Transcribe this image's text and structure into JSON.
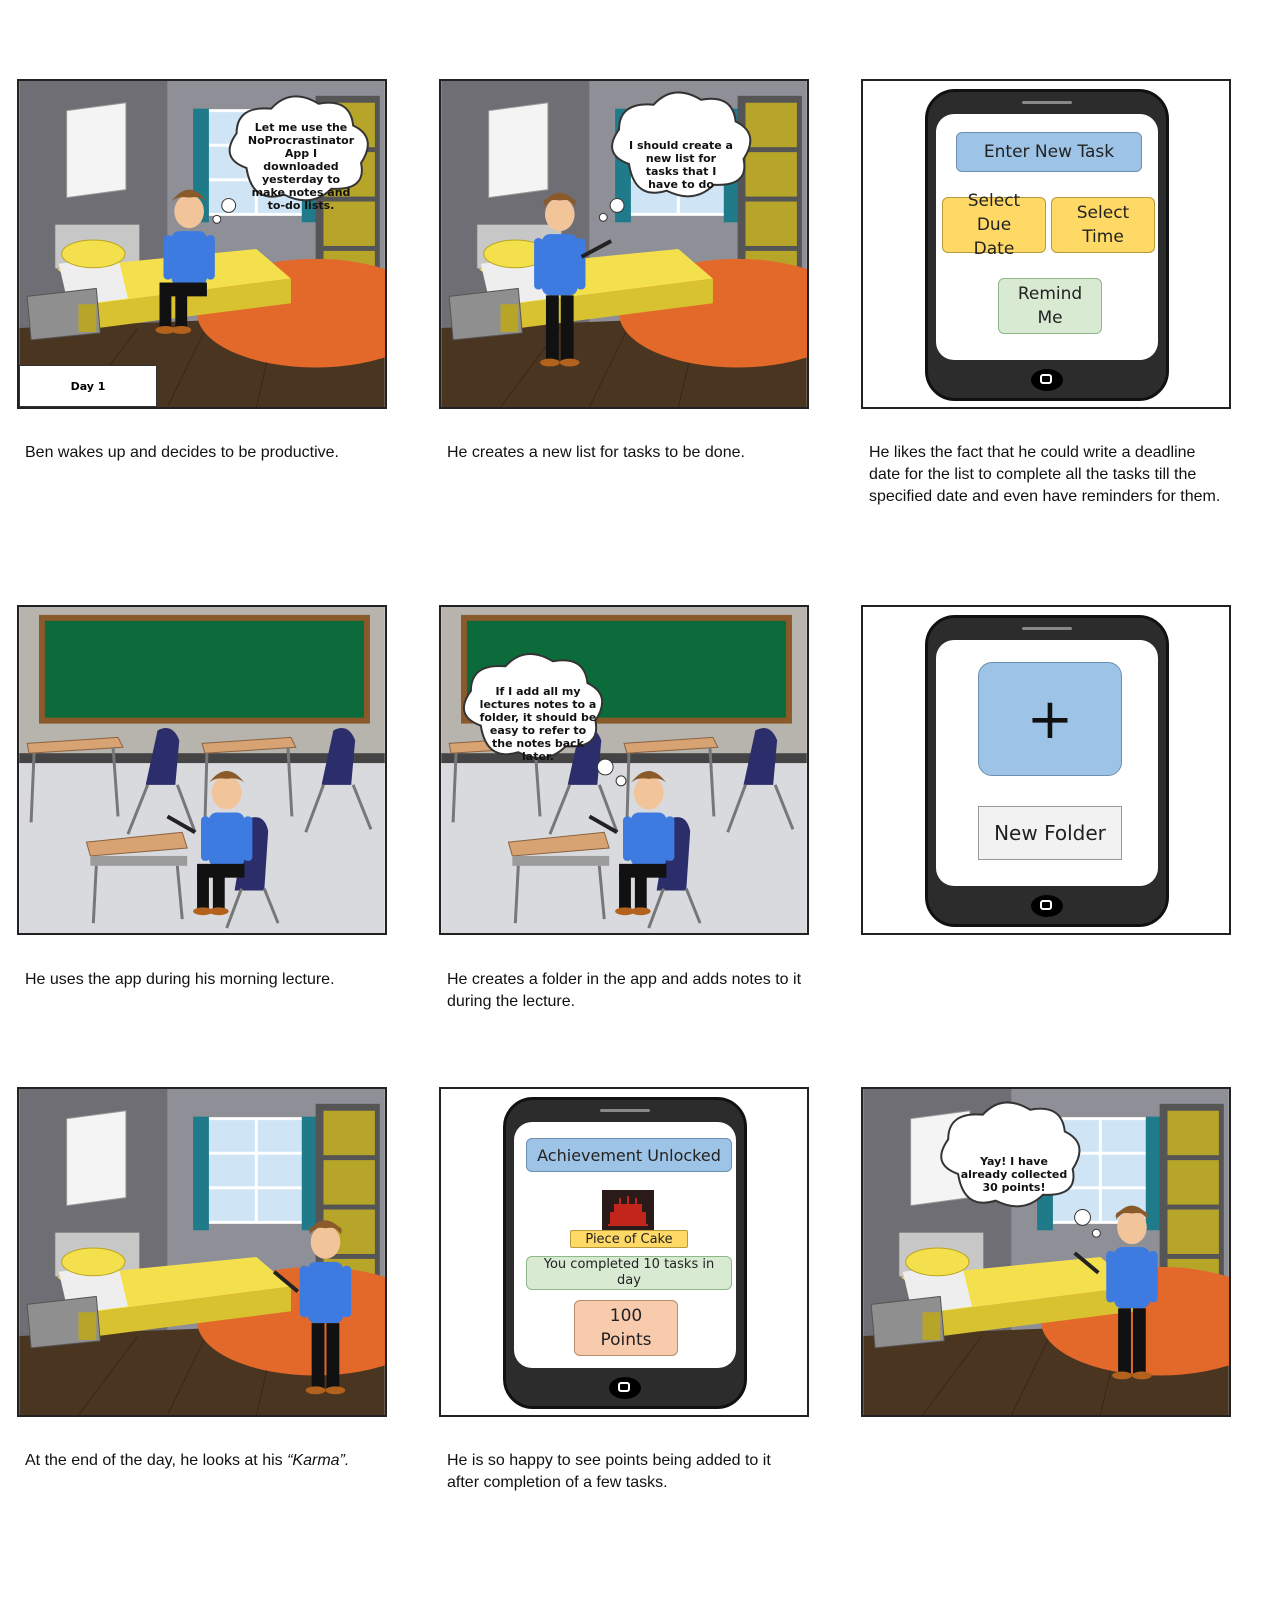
{
  "panels": {
    "p1": {
      "bubble": "Let me use the NoProcrastinator App I downloaded yesterday to make notes and to-do lists.",
      "day_label": "Day 1",
      "caption": "Ben wakes up and decides to be productive."
    },
    "p2": {
      "bubble": "I should create a new list for tasks that I have to do",
      "caption": "He creates a new list for tasks to be done."
    },
    "p3": {
      "buttons": {
        "enter_task": "Enter New Task",
        "due_date": "Select Due Date",
        "time": "Select Time",
        "remind": "Remind Me"
      },
      "caption": "He likes the fact that he could write a deadline date for the list to complete all the tasks till the specified date and even have reminders for them."
    },
    "p4": {
      "caption": "He uses the app during his morning lecture."
    },
    "p5": {
      "bubble": "If I add all my lectures notes to a folder, it should be easy to refer to the notes back later.",
      "caption": "He creates a folder in the app and adds notes to it during the lecture."
    },
    "p6": {
      "plus": "+",
      "new_folder": "New Folder"
    },
    "p7": {
      "caption_prefix": "At the end of the day, he looks at his ",
      "caption_emph": "“Karma”."
    },
    "p8": {
      "achievement": "Achievement Unlocked",
      "badge": "Piece of Cake",
      "message": "You completed 10 tasks in day",
      "points": "100 Points",
      "caption": "He is so happy to see points being added to it after completion of a few tasks."
    },
    "p9": {
      "bubble": "Yay! I have already collected 30 points!"
    }
  },
  "colors": {
    "wall": "#8a8a8a",
    "bed_yellow": "#f4e04d",
    "rug": "#e3692a",
    "floor": "#4a3520",
    "chalkboard": "#0b6b3a",
    "shirt": "#3d7be0"
  }
}
